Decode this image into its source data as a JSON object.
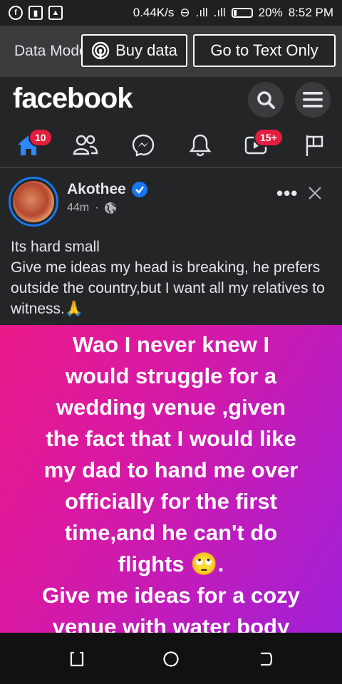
{
  "status_bar": {
    "speed": "0.44K/s",
    "battery": "20%",
    "time": "8:52 PM"
  },
  "data_mode": {
    "label": "Data Mode",
    "buy_button": "Buy data",
    "text_only_button": "Go to Text Only"
  },
  "header": {
    "logo": "facebook"
  },
  "nav": {
    "home_badge": "10",
    "video_badge": "15+"
  },
  "post": {
    "author": "Akothee",
    "time": "44m",
    "separator": "·",
    "text_lines": [
      "Its hard small",
      "Give me ideas my head is breaking, he prefers outside the country,but I want all my relatives to witness.🙏"
    ],
    "image_text_lines": [
      "Wao I never knew I",
      "would struggle for a",
      "wedding venue ,given",
      "the fact that I would like",
      "my dad to hand me over",
      "officially for the first",
      "time,and he can't do",
      "flights 🙄.",
      "Give me ideas for a cozy",
      "venue with water body"
    ]
  },
  "colors": {
    "accent": "#1877f2",
    "badge": "#e41e3f",
    "background": "#242526"
  }
}
